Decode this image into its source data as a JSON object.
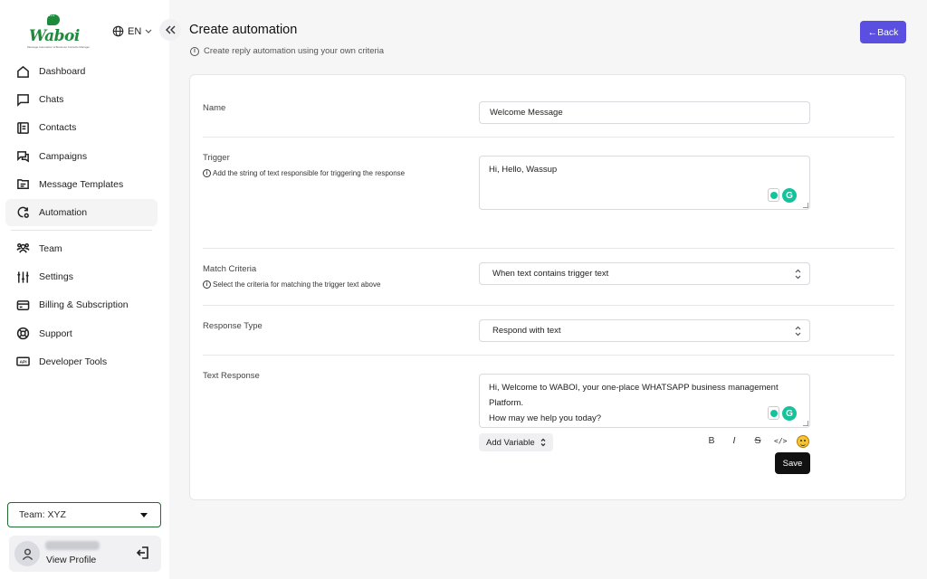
{
  "app": {
    "logo_text": "Waboi",
    "logo_tagline": "Message Automation & Business Contacts Manager",
    "language": "EN",
    "brand_color": "#1e8a3c",
    "accent_color": "#5a4fe0"
  },
  "sidebar": {
    "items": [
      {
        "label": "Dashboard",
        "icon": "home-icon"
      },
      {
        "label": "Chats",
        "icon": "chat-icon"
      },
      {
        "label": "Contacts",
        "icon": "contacts-icon"
      },
      {
        "label": "Campaigns",
        "icon": "campaigns-icon"
      },
      {
        "label": "Message Templates",
        "icon": "template-icon"
      },
      {
        "label": "Automation",
        "icon": "automation-icon",
        "active": true
      },
      {
        "label": "Team",
        "icon": "team-icon"
      },
      {
        "label": "Settings",
        "icon": "sliders-icon"
      },
      {
        "label": "Billing & Subscription",
        "icon": "card-icon"
      },
      {
        "label": "Support",
        "icon": "lifebuoy-icon"
      },
      {
        "label": "Developer Tools",
        "icon": "api-icon"
      }
    ],
    "team_select": "Team: XYZ",
    "profile_link": "View Profile"
  },
  "header": {
    "title": "Create automation",
    "subtitle": "Create reply automation using your own criteria",
    "back_label": "←Back"
  },
  "form": {
    "name": {
      "label": "Name",
      "value": "Welcome Message"
    },
    "trigger": {
      "label": "Trigger",
      "help": "Add the string of text responsible for triggering the response",
      "value": "Hi, Hello, Wassup"
    },
    "match_criteria": {
      "label": "Match Criteria",
      "help": "Select the criteria for matching the trigger text above",
      "value": "When text contains trigger text"
    },
    "response_type": {
      "label": "Response Type",
      "value": "Respond with text"
    },
    "text_response": {
      "label": "Text Response",
      "line1": "Hi, Welcome to WABOI, your one-place WHATSAPP business management",
      "line2": "Platform.",
      "line3": "How may we help you today?"
    },
    "add_variable": "Add Variable",
    "toolbar": {
      "bold": "B",
      "italic": "I",
      "strike": "S",
      "code": "</>"
    },
    "save_label": "Save"
  }
}
